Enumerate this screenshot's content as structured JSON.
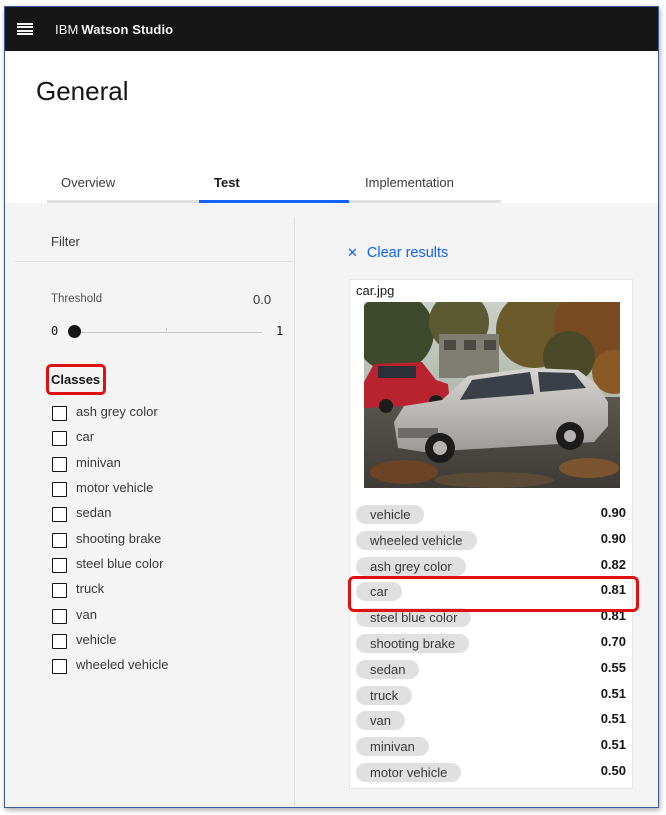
{
  "app": {
    "brand_prefix": "IBM",
    "brand_name": "Watson Studio"
  },
  "page": {
    "title": "General"
  },
  "tabs": [
    {
      "label": "Overview",
      "active": false
    },
    {
      "label": "Test",
      "active": true
    },
    {
      "label": "Implementation",
      "active": false
    }
  ],
  "filter": {
    "title": "Filter",
    "threshold_label": "Threshold",
    "threshold_value": "0.0",
    "slider_min": "0",
    "slider_max": "1",
    "classes_title": "Classes",
    "classes": [
      {
        "label": "ash grey color",
        "checked": false
      },
      {
        "label": "car",
        "checked": false
      },
      {
        "label": "minivan",
        "checked": false
      },
      {
        "label": "motor vehicle",
        "checked": false
      },
      {
        "label": "sedan",
        "checked": false
      },
      {
        "label": "shooting brake",
        "checked": false
      },
      {
        "label": "steel blue color",
        "checked": false
      },
      {
        "label": "truck",
        "checked": false
      },
      {
        "label": "van",
        "checked": false
      },
      {
        "label": "vehicle",
        "checked": false
      },
      {
        "label": "wheeled vehicle",
        "checked": false
      }
    ]
  },
  "results": {
    "clear_label": "Clear results",
    "filename": "car.jpg",
    "labels": [
      {
        "name": "vehicle",
        "score": "0.90"
      },
      {
        "name": "wheeled vehicle",
        "score": "0.90"
      },
      {
        "name": "ash grey color",
        "score": "0.82"
      },
      {
        "name": "car",
        "score": "0.81"
      },
      {
        "name": "steel blue color",
        "score": "0.81"
      },
      {
        "name": "shooting brake",
        "score": "0.70"
      },
      {
        "name": "sedan",
        "score": "0.55"
      },
      {
        "name": "truck",
        "score": "0.51"
      },
      {
        "name": "van",
        "score": "0.51"
      },
      {
        "name": "minivan",
        "score": "0.51"
      },
      {
        "name": "motor vehicle",
        "score": "0.50"
      }
    ]
  },
  "colors": {
    "accent": "#0f62fe",
    "topbar": "#161616",
    "highlight": "#e01010",
    "pill": "#e0e0e0"
  }
}
